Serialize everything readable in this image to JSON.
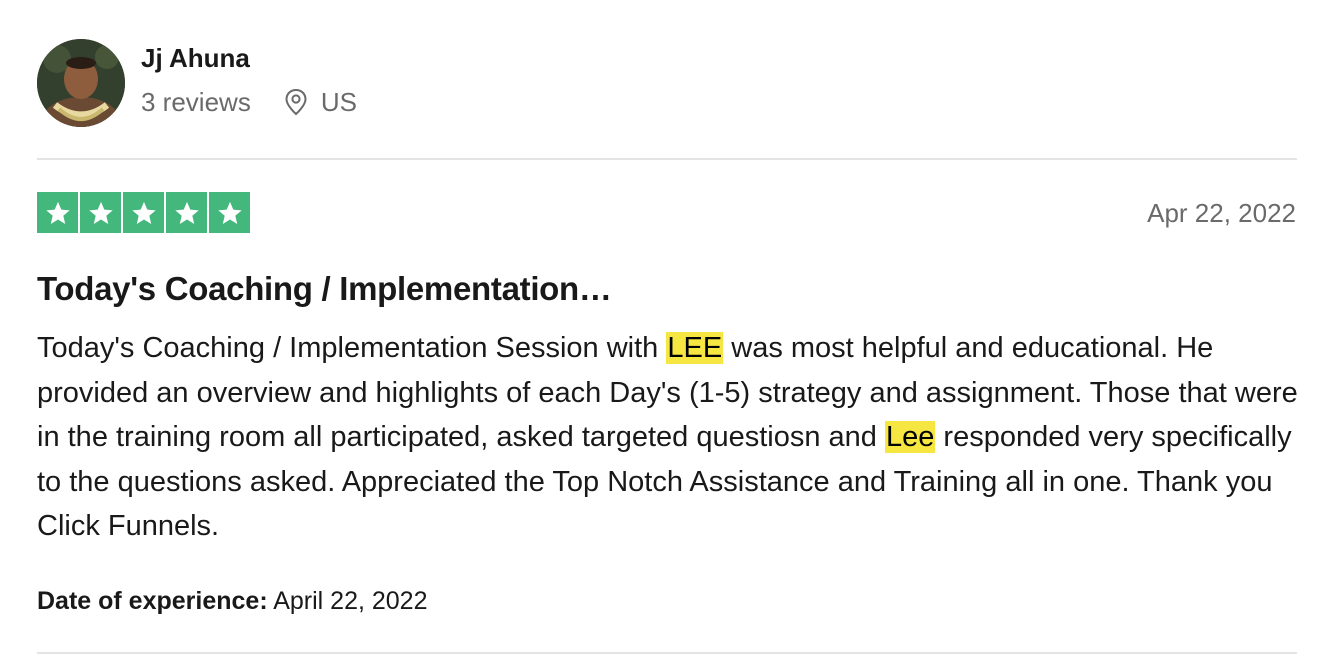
{
  "reviewer": {
    "name": "Jj Ahuna",
    "reviews_count": "3 reviews",
    "location": "US",
    "location_icon": "map-pin-icon"
  },
  "review": {
    "rating": 5,
    "rating_max": 5,
    "star_color": "#43b77c",
    "date": "Apr 22, 2022",
    "title": "Today's Coaching / Implementation…",
    "body_segments": [
      {
        "text": "Today's Coaching / Implementation Session with ",
        "highlight": false
      },
      {
        "text": "LEE",
        "highlight": true
      },
      {
        "text": " was most helpful and educational. He provided an overview and highlights of each Day's (1-5) strategy and assignment. Those that were in the training room all participated, asked targeted questiosn and ",
        "highlight": false
      },
      {
        "text": "Lee",
        "highlight": true
      },
      {
        "text": " responded very specifically to the questions asked. Appreciated the Top Notch Assistance and Training all in one. Thank you Click Funnels.",
        "highlight": false
      }
    ],
    "highlight_color": "#f5e642",
    "experience_label": "Date of experience:",
    "experience_date": "April 22, 2022"
  }
}
